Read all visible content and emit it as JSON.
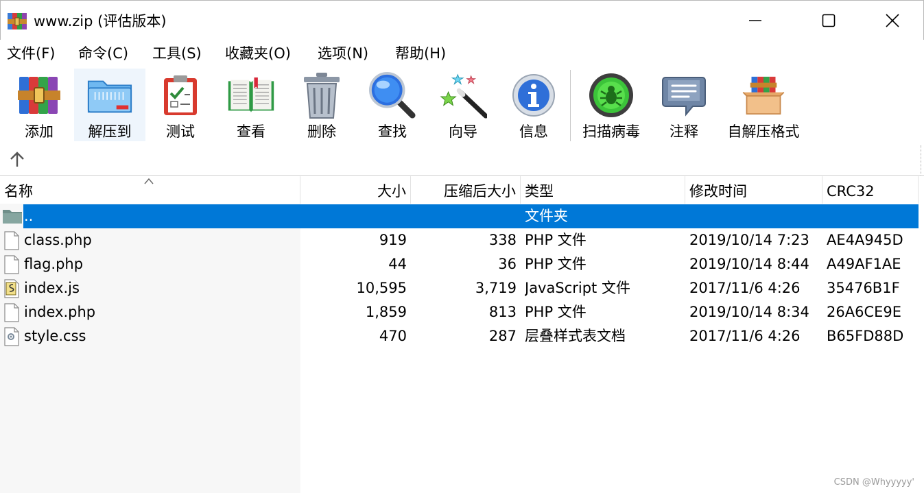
{
  "window": {
    "title": "www.zip (评估版本)"
  },
  "menu": [
    {
      "label": "文件(F)"
    },
    {
      "label": "命令(C)"
    },
    {
      "label": "工具(S)"
    },
    {
      "label": "收藏夹(O)"
    },
    {
      "label": "选项(N)"
    },
    {
      "label": "帮助(H)"
    }
  ],
  "toolbar": [
    {
      "label": "添加",
      "icon": "add-archive-icon"
    },
    {
      "label": "解压到",
      "icon": "extract-folder-icon"
    },
    {
      "label": "测试",
      "icon": "test-clipboard-icon"
    },
    {
      "label": "查看",
      "icon": "view-book-icon"
    },
    {
      "label": "删除",
      "icon": "delete-trash-icon"
    },
    {
      "label": "查找",
      "icon": "find-magnifier-icon"
    },
    {
      "label": "向导",
      "icon": "wizard-wand-icon"
    },
    {
      "label": "信息",
      "icon": "info-icon"
    },
    {
      "label": "扫描病毒",
      "icon": "virus-scan-icon"
    },
    {
      "label": "注释",
      "icon": "comment-icon"
    },
    {
      "label": "自解压格式",
      "icon": "sfx-box-icon"
    }
  ],
  "columns": {
    "name": "名称",
    "size": "大小",
    "packed": "压缩后大小",
    "type": "类型",
    "modified": "修改时间",
    "crc": "CRC32"
  },
  "rows": [
    {
      "name": "..",
      "size": "",
      "packed": "",
      "type": "文件夹",
      "modified": "",
      "crc": "",
      "icon": "folder-icon"
    },
    {
      "name": "class.php",
      "size": "919",
      "packed": "338",
      "type": "PHP 文件",
      "modified": "2019/10/14 7:23",
      "crc": "AE4A945D",
      "icon": "file-icon"
    },
    {
      "name": "flag.php",
      "size": "44",
      "packed": "36",
      "type": "PHP 文件",
      "modified": "2019/10/14 8:44",
      "crc": "A49AF1AE",
      "icon": "file-icon"
    },
    {
      "name": "index.js",
      "size": "10,595",
      "packed": "3,719",
      "type": "JavaScript 文件",
      "modified": "2017/11/6 4:26",
      "crc": "35476B1F",
      "icon": "script-file-icon"
    },
    {
      "name": "index.php",
      "size": "1,859",
      "packed": "813",
      "type": "PHP 文件",
      "modified": "2019/10/14 8:34",
      "crc": "26A6CE9E",
      "icon": "file-icon"
    },
    {
      "name": "style.css",
      "size": "470",
      "packed": "287",
      "type": "层叠样式表文档",
      "modified": "2017/11/6 4:26",
      "crc": "B65FD88D",
      "icon": "css-file-icon"
    }
  ],
  "watermark": "CSDN @Whyyyyy'",
  "colors": {
    "selection": "#0078d7",
    "name_column_bg": "#f7f7f7"
  }
}
